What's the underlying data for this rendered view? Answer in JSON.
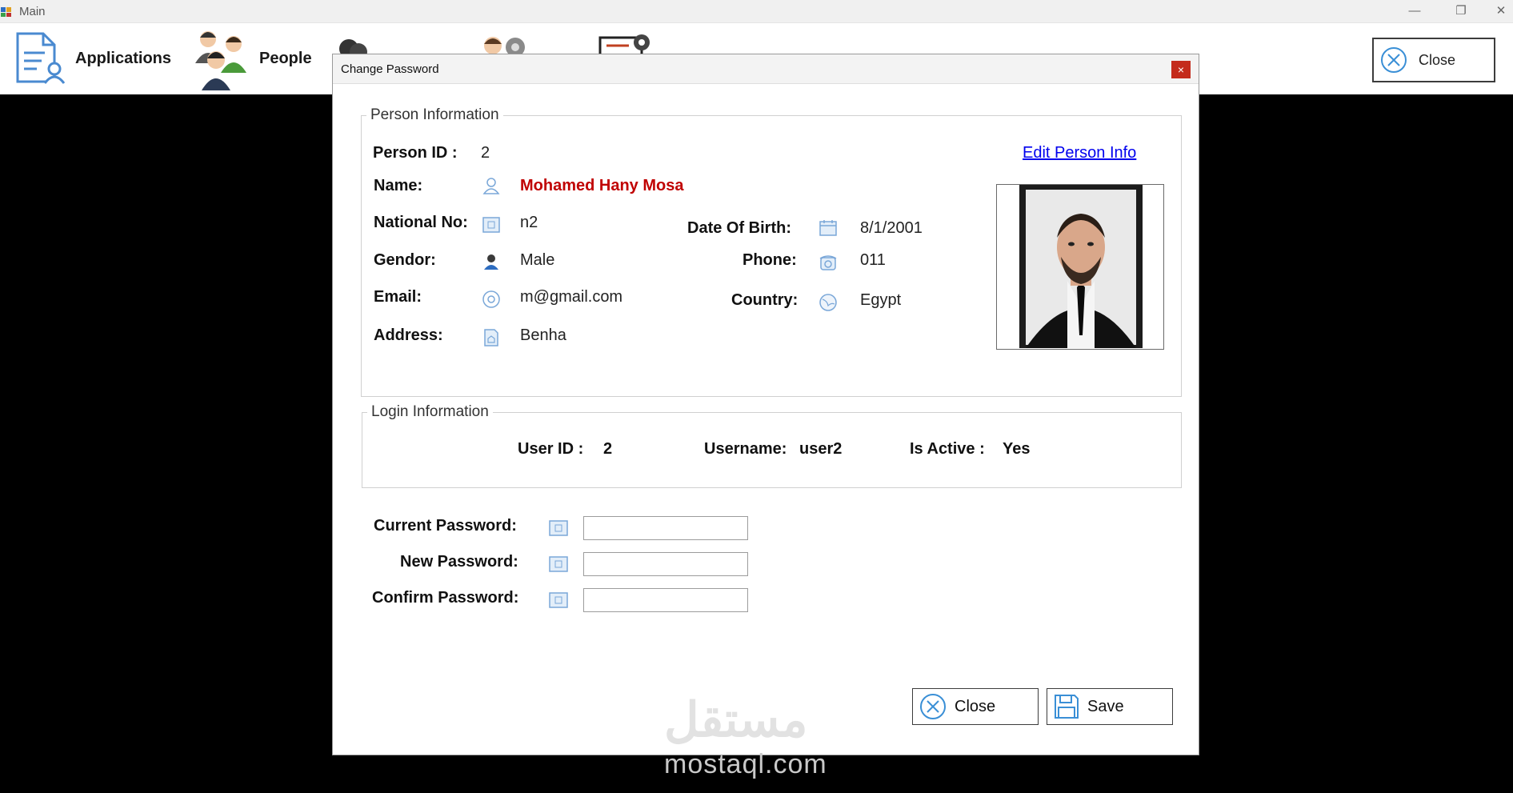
{
  "window": {
    "title": "Main",
    "min_symbol": "—",
    "restore_symbol": "❐",
    "close_symbol": "✕"
  },
  "toolbar": {
    "applications_label": "Applications",
    "people_label": "People",
    "close_label": "Close"
  },
  "dialog": {
    "title": "Change Password",
    "close_symbol": "×",
    "person_info": {
      "legend": "Person Information",
      "person_id_label": "Person ID :",
      "person_id": "2",
      "edit_link": "Edit Person Info",
      "name_label": "Name:",
      "name": "Mohamed Hany  Mosa",
      "national_no_label": "National No:",
      "national_no": "n2",
      "dob_label": "Date Of Birth:",
      "dob": "8/1/2001",
      "gender_label": "Gendor:",
      "gender": "Male",
      "phone_label": "Phone:",
      "phone": "011",
      "email_label": "Email:",
      "email": "m@gmail.com",
      "country_label": "Country:",
      "country": "Egypt",
      "address_label": "Address:",
      "address": "Benha"
    },
    "login_info": {
      "legend": "Login Information",
      "user_id_label": "User ID :",
      "user_id": "2",
      "username_label": "Username:",
      "username": "user2",
      "is_active_label": "Is Active :",
      "is_active": "Yes"
    },
    "password": {
      "current_label": "Current Password:",
      "current_value": "",
      "new_label": "New Password:",
      "new_value": "",
      "confirm_label": "Confirm Password:",
      "confirm_value": ""
    },
    "buttons": {
      "close_label": "Close",
      "save_label": "Save"
    }
  },
  "watermark": {
    "arabic": "مستقل",
    "latin": "mostaql.com"
  },
  "colors": {
    "name_red": "#c00000",
    "link_blue": "#0000ee",
    "icon_blue": "#3a8fd6"
  }
}
